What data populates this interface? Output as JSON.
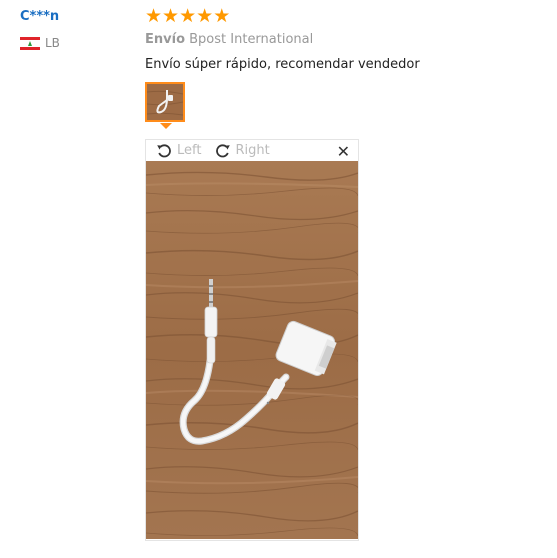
{
  "reviewer": {
    "name": "C***n",
    "country_code": "LB",
    "flag_icon": "lebanon-flag-icon"
  },
  "rating": {
    "stars": 5,
    "max": 5,
    "star_glyph": "★",
    "color": "#ff9900"
  },
  "shipping": {
    "label": "Envío",
    "carrier": "Bpost International"
  },
  "review_text": "Envío súper rápido, recomendar vendedor",
  "viewer": {
    "rotate_left_label": "Left",
    "rotate_right_label": "Right",
    "close_glyph": "✕",
    "photo_subject": "white-usb-audio-adapter-cable-on-wood"
  },
  "colors": {
    "accent": "#ff8c1a",
    "username": "#1a6ec2"
  }
}
